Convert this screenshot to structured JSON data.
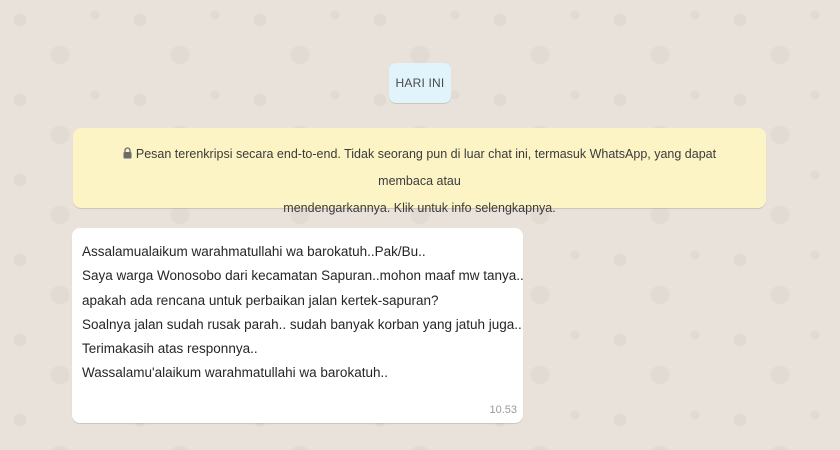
{
  "date_chip": {
    "label": "HARI INI"
  },
  "encryption_notice": {
    "icon": "lock-icon",
    "line1": "Pesan terenkripsi secara end-to-end. Tidak seorang pun di luar chat ini, termasuk WhatsApp, yang dapat membaca atau",
    "line2": "mendengarkannya. Klik untuk info selengkapnya."
  },
  "message": {
    "lines": [
      "Assalamualaikum warahmatullahi wa barokatuh..Pak/Bu..",
      "Saya warga Wonosobo dari kecamatan Sapuran..mohon maaf mw tanya..",
      "apakah ada rencana untuk perbaikan jalan kertek-sapuran?",
      "Soalnya jalan sudah rusak parah.. sudah banyak korban yang jatuh juga..",
      "Terimakasih atas responnya..",
      "Wassalamu'alaikum warahmatullahi wa barokatuh.."
    ],
    "time": "10.53"
  },
  "colors": {
    "chat_background": "#e9e2da",
    "date_chip_bg": "#e1f3fb",
    "notice_bg": "#fcf4c4",
    "bubble_bg": "#ffffff"
  }
}
